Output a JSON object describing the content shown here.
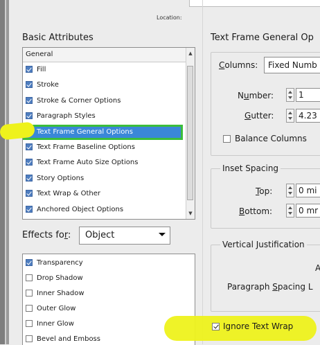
{
  "header": {
    "location_label": "Location:"
  },
  "basic_attributes": {
    "title": "Basic Attributes",
    "list_header": "General",
    "items": [
      {
        "label": "Fill",
        "checked": true
      },
      {
        "label": "Stroke",
        "checked": true
      },
      {
        "label": "Stroke & Corner Options",
        "checked": true
      },
      {
        "label": "Paragraph Styles",
        "checked": true
      },
      {
        "label": "Text Frame General Options",
        "checked": true,
        "selected": true
      },
      {
        "label": "Text Frame Baseline Options",
        "checked": true
      },
      {
        "label": "Text Frame Auto Size Options",
        "checked": true
      },
      {
        "label": "Story Options",
        "checked": true
      },
      {
        "label": "Text Wrap & Other",
        "checked": true
      },
      {
        "label": "Anchored Object Options",
        "checked": true
      }
    ]
  },
  "effects": {
    "label": "Effects for:",
    "selected": "Object",
    "items": [
      {
        "label": "Transparency",
        "checked": true
      },
      {
        "label": "Drop Shadow",
        "checked": false
      },
      {
        "label": "Inner Shadow",
        "checked": false
      },
      {
        "label": "Outer Glow",
        "checked": false
      },
      {
        "label": "Inner Glow",
        "checked": false
      },
      {
        "label": "Bevel and Emboss",
        "checked": false
      }
    ]
  },
  "text_frame": {
    "title": "Text Frame General Op",
    "columns_label": "Columns:",
    "columns_value": "Fixed Numb",
    "number_label": "Number:",
    "number_value": "1",
    "gutter_label": "Gutter:",
    "gutter_value": "4.23",
    "balance_label": "Balance Columns",
    "balance_checked": false,
    "inset_title": "Inset Spacing",
    "top_label": "Top:",
    "top_value": "0 mi",
    "bottom_label": "Bottom:",
    "bottom_value": "0 mr",
    "vj_title": "Vertical Justification",
    "vj_partial": "A",
    "para_spacing_label": "Paragraph Spacing L",
    "ignore_wrap_label": "Ignore Text Wrap",
    "ignore_wrap_checked": true
  },
  "colors": {
    "selection": "#3a87d8",
    "highlight": "#eef21c",
    "checkbox_checked": "#4f7ec0"
  }
}
